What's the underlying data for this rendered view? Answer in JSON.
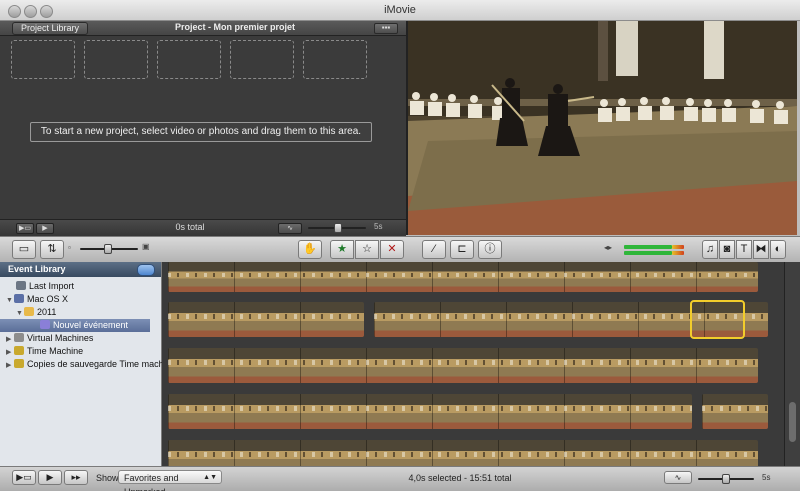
{
  "window": {
    "title": "iMovie"
  },
  "project": {
    "library_button": "Project Library",
    "title": "Project - Mon premier projet",
    "options_button": "▪▪▪",
    "drop_message": "To start a new project, select video or photos and drag them to this area.",
    "total": "0s total",
    "zoom_label": "5s"
  },
  "toolbar": {
    "tools": [
      "camera-import",
      "swap-events-projects",
      "adjust-time",
      "favorite-star",
      "unmark-star",
      "reject",
      "dropper",
      "crop",
      "inspector"
    ],
    "right_buttons": [
      "music",
      "photos",
      "titles",
      "transitions",
      "maps"
    ]
  },
  "sidebar": {
    "header": "Event Library",
    "items": [
      {
        "label": "Last Import",
        "icon": "film-strip-icon"
      },
      {
        "label": "Mac OS X",
        "icon": "disk-icon"
      },
      {
        "label": "2011",
        "icon": "calendar-icon"
      },
      {
        "label": "Nouvel événement",
        "icon": "star-event-icon"
      },
      {
        "label": "Virtual Machines",
        "icon": "drive-icon"
      },
      {
        "label": "Time Machine",
        "icon": "time-machine-icon"
      },
      {
        "label": "Copies de sauvegarde Time machine",
        "icon": "time-machine-icon"
      }
    ]
  },
  "statusbar": {
    "show_label": "Show:",
    "filter_value": "Favorites and Unmarked",
    "selection_info": "4,0s selected - 15:51 total",
    "zoom_label": "5s"
  },
  "colors": {
    "selection": "#f2cd2b",
    "sidebar_header": "#4a5d76"
  }
}
